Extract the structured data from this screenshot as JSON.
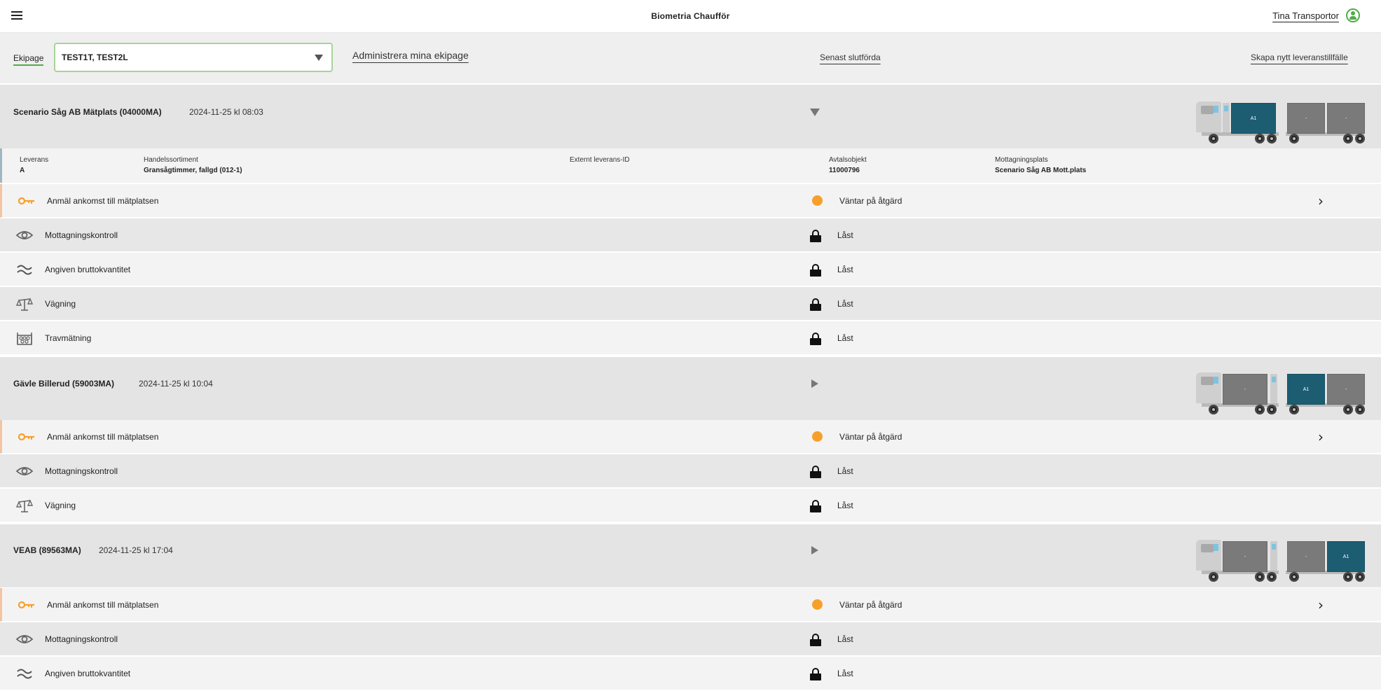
{
  "app": {
    "title": "Biometria Chaufför",
    "user_name": "Tina Transportor"
  },
  "toolbar": {
    "ekipage_label": "Ekipage",
    "ekipage_value": "TEST1T, TEST2L",
    "manage_link": "Administrera mina ekipage",
    "recent_link": "Senast slutförda",
    "create_link": "Skapa nytt leveranstillfälle"
  },
  "icons": {
    "key": "key-icon",
    "eye": "eye-icon",
    "approx": "approx-icon",
    "scale": "scale-icon",
    "stack": "log-stack-icon",
    "waiting": "orange-dot-icon",
    "locked": "lock-icon"
  },
  "colors": {
    "accent_green": "#4fae48",
    "waiting_orange": "#f6a02a",
    "active_box": "#1c5d72",
    "inactive_box": "#7a7a7a"
  },
  "deliveries": [
    {
      "title": "Scenario Såg AB Mätplats (04000MA)",
      "date": "2024-11-25 kl 08:03",
      "expanded": true,
      "truck_boxes": [
        "A1",
        "-",
        "-"
      ],
      "info": {
        "leverans": {
          "label": "Leverans",
          "value": "A"
        },
        "handelssortiment": {
          "label": "Handelssortiment",
          "value": "Gransågtimmer, fallgd (012-1)"
        },
        "externt": {
          "label": "Externt leverans-ID",
          "value": ""
        },
        "avtalsobjekt": {
          "label": "Avtalsobjekt",
          "value": "11000796"
        },
        "mottagningsplats": {
          "label": "Mottagningsplats",
          "value": "Scenario Såg AB Mott.plats"
        }
      },
      "steps": [
        {
          "label": "Anmäl ankomst till mätplatsen",
          "status": "Väntar på åtgärd"
        },
        {
          "label": "Mottagningskontroll",
          "status": "Låst"
        },
        {
          "label": "Angiven bruttokvantitet",
          "status": "Låst"
        },
        {
          "label": "Vägning",
          "status": "Låst"
        },
        {
          "label": "Travmätning",
          "status": "Låst"
        }
      ]
    },
    {
      "title": "Gävle Billerud (59003MA)",
      "date": "2024-11-25 kl 10:04",
      "expanded": false,
      "truck_boxes": [
        "-",
        "A1",
        "-"
      ],
      "steps": [
        {
          "label": "Anmäl ankomst till mätplatsen",
          "status": "Väntar på åtgärd"
        },
        {
          "label": "Mottagningskontroll",
          "status": "Låst"
        },
        {
          "label": "Vägning",
          "status": "Låst"
        }
      ]
    },
    {
      "title": "VEAB (89563MA)",
      "date": "2024-11-25 kl 17:04",
      "expanded": false,
      "truck_boxes": [
        "-",
        "-",
        "A1"
      ],
      "steps": [
        {
          "label": "Anmäl ankomst till mätplatsen",
          "status": "Väntar på åtgärd"
        },
        {
          "label": "Mottagningskontroll",
          "status": "Låst"
        },
        {
          "label": "Angiven bruttokvantitet",
          "status": "Låst"
        }
      ]
    }
  ]
}
